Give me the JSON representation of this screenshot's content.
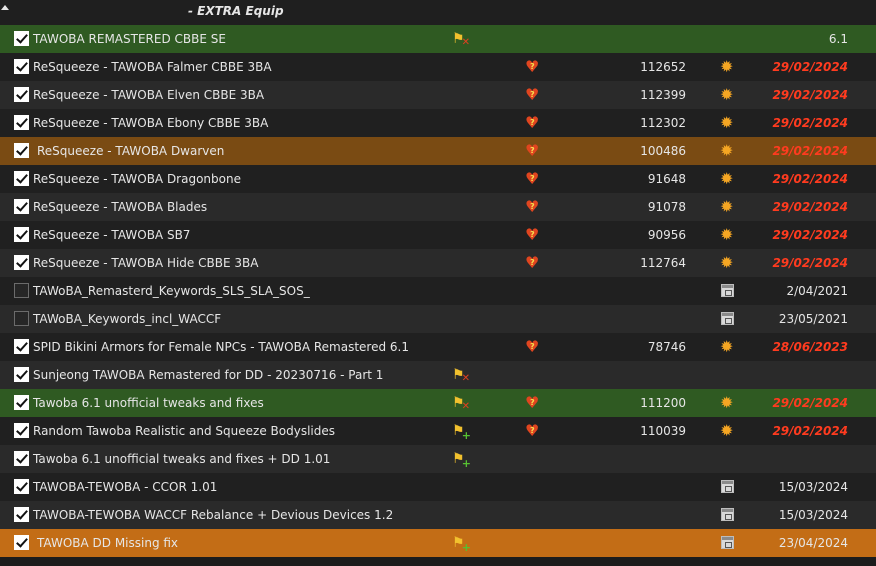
{
  "header": {
    "title": "- EXTRA Equip"
  },
  "colors": {
    "green_row": "#2f5a22",
    "brown_row": "#7a4b13",
    "orange_row": "#c36d16",
    "red_date": "#ff3b1f"
  },
  "rows": [
    {
      "checked": true,
      "name": "TAWOBA REMASTERED CBBE SE",
      "flag": "flag-cross-icon",
      "heart": false,
      "mid": "",
      "status": "",
      "date": "6.1",
      "date_style": "white",
      "bg": "green"
    },
    {
      "checked": true,
      "name": "ReSqueeze - TAWOBA Falmer CBBE 3BA",
      "flag": "",
      "heart": true,
      "mid": "112652",
      "status": "burst",
      "date": "29/02/2024",
      "date_style": "red",
      "bg": "odd"
    },
    {
      "checked": true,
      "name": "ReSqueeze - TAWOBA Elven CBBE 3BA",
      "flag": "",
      "heart": true,
      "mid": "112399",
      "status": "burst",
      "date": "29/02/2024",
      "date_style": "red",
      "bg": "even"
    },
    {
      "checked": true,
      "name": "ReSqueeze - TAWOBA Ebony CBBE 3BA",
      "flag": "",
      "heart": true,
      "mid": "112302",
      "status": "burst",
      "date": "29/02/2024",
      "date_style": "red",
      "bg": "odd"
    },
    {
      "checked": true,
      "name": "ReSqueeze - TAWOBA Dwarven",
      "flag": "",
      "heart": true,
      "mid": "100486",
      "status": "burst",
      "date": "29/02/2024",
      "date_style": "red",
      "bg": "brown"
    },
    {
      "checked": true,
      "name": "ReSqueeze - TAWOBA Dragonbone",
      "flag": "",
      "heart": true,
      "mid": "91648",
      "status": "burst",
      "date": "29/02/2024",
      "date_style": "red",
      "bg": "odd"
    },
    {
      "checked": true,
      "name": "ReSqueeze - TAWOBA Blades",
      "flag": "",
      "heart": true,
      "mid": "91078",
      "status": "burst",
      "date": "29/02/2024",
      "date_style": "red",
      "bg": "even"
    },
    {
      "checked": true,
      "name": "ReSqueeze - TAWOBA SB7",
      "flag": "",
      "heart": true,
      "mid": "90956",
      "status": "burst",
      "date": "29/02/2024",
      "date_style": "red",
      "bg": "odd"
    },
    {
      "checked": true,
      "name": "ReSqueeze - TAWOBA Hide CBBE 3BA",
      "flag": "",
      "heart": true,
      "mid": "112764",
      "status": "burst",
      "date": "29/02/2024",
      "date_style": "red",
      "bg": "even"
    },
    {
      "checked": false,
      "name": "TAWoBA_Remasterd_Keywords_SLS_SLA_SOS_",
      "flag": "",
      "heart": false,
      "mid": "",
      "status": "calendar",
      "date": "2/04/2021",
      "date_style": "white",
      "bg": "odd"
    },
    {
      "checked": false,
      "name": "TAWoBA_Keywords_incl_WACCF",
      "flag": "",
      "heart": false,
      "mid": "",
      "status": "calendar",
      "date": "23/05/2021",
      "date_style": "white",
      "bg": "even"
    },
    {
      "checked": true,
      "name": "SPID Bikini Armors for Female NPCs - TAWOBA Remastered 6.1",
      "flag": "",
      "heart": true,
      "mid": "78746",
      "status": "burst",
      "date": "28/06/2023",
      "date_style": "red",
      "bg": "odd"
    },
    {
      "checked": true,
      "name": "Sunjeong TAWOBA Remastered for DD - 20230716 - Part 1",
      "flag": "flag-cross-icon",
      "heart": false,
      "mid": "",
      "status": "",
      "date": "",
      "date_style": "white",
      "bg": "even"
    },
    {
      "checked": true,
      "name": "Tawoba 6.1 unofficial tweaks and fixes",
      "flag": "flag-cross-icon",
      "heart": true,
      "mid": "111200",
      "status": "burst",
      "date": "29/02/2024",
      "date_style": "red",
      "bg": "green"
    },
    {
      "checked": true,
      "name": "Random Tawoba Realistic and Squeeze Bodyslides",
      "flag": "flag-plus-icon",
      "heart": true,
      "mid": "110039",
      "status": "burst",
      "date": "29/02/2024",
      "date_style": "red",
      "bg": "odd"
    },
    {
      "checked": true,
      "name": "Tawoba 6.1 unofficial tweaks and fixes + DD 1.01",
      "flag": "flag-plus-icon",
      "heart": false,
      "mid": "",
      "status": "",
      "date": "",
      "date_style": "white",
      "bg": "even"
    },
    {
      "checked": true,
      "name": "TAWOBA-TEWOBA - CCOR 1.01",
      "flag": "",
      "heart": false,
      "mid": "",
      "status": "calendar",
      "date": "15/03/2024",
      "date_style": "white",
      "bg": "odd"
    },
    {
      "checked": true,
      "name": "TAWOBA-TEWOBA WACCF Rebalance + Devious Devices 1.2",
      "flag": "",
      "heart": false,
      "mid": "",
      "status": "calendar",
      "date": "15/03/2024",
      "date_style": "white",
      "bg": "even"
    },
    {
      "checked": true,
      "name": "TAWOBA DD Missing fix",
      "flag": "flag-plus-icon",
      "heart": false,
      "mid": "",
      "status": "calendar",
      "date": "23/04/2024",
      "date_style": "white",
      "bg": "orange"
    }
  ]
}
